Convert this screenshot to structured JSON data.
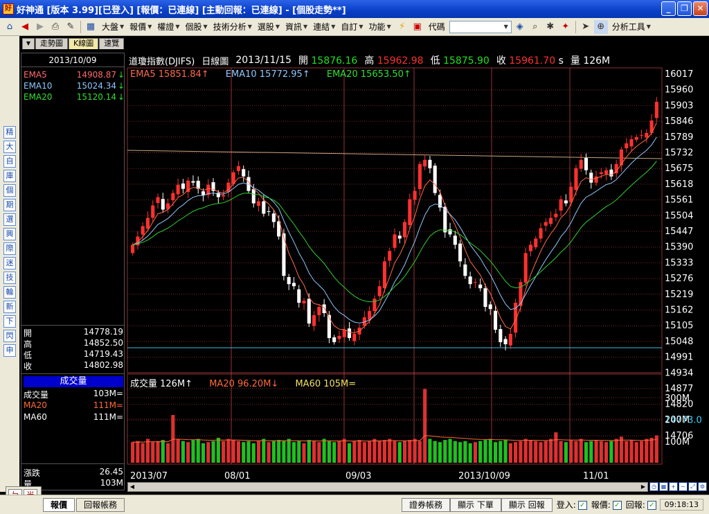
{
  "window": {
    "title": "好神通 [版本 3.99][已登入] [報價：已連線] [主動回報：已連線] - [個股走勢**]",
    "app_icon_glyph": "好",
    "buttons": {
      "minimize": "_",
      "restore": "❐",
      "close": "✕"
    }
  },
  "toolbar": {
    "menus": [
      "大盤",
      "報價",
      "權證",
      "個股",
      "技術分析",
      "選股",
      "資訊",
      "連結",
      "自訂",
      "功能"
    ],
    "code_label": "代碼",
    "code_value": "",
    "analysis_tools": "分析工具"
  },
  "side_buttons": [
    "精",
    "大",
    "自",
    "庫",
    "個",
    "期",
    "選",
    "興",
    "際",
    "迷",
    "技",
    "輪",
    "新",
    "下",
    "閃",
    "申"
  ],
  "tabs": [
    "走勢圖",
    "K線圖",
    "速覽"
  ],
  "left_panel": {
    "date": "2013/10/09",
    "ema": [
      {
        "name": "EMA5",
        "value": "14908.87",
        "arrow": "↓",
        "color": "#ff6a6a"
      },
      {
        "name": "EMA10",
        "value": "15024.34",
        "arrow": "↓",
        "color": "#8ec8ff"
      },
      {
        "name": "EMA20",
        "value": "15120.14",
        "arrow": "↓",
        "color": "#30e030"
      }
    ],
    "ohlc": [
      {
        "label": "開",
        "value": "14778.19"
      },
      {
        "label": "高",
        "value": "14852.50"
      },
      {
        "label": "低",
        "value": "14719.43"
      },
      {
        "label": "收",
        "value": "14802.98"
      }
    ],
    "volume_header": "成交量",
    "volume": [
      {
        "label": "成交量",
        "value": "103M=",
        "color": "#ffffff"
      },
      {
        "label": "MA20",
        "value": "111M=",
        "color": "#ff6a3a"
      },
      {
        "label": "MA60",
        "value": "111M=",
        "color": "#ffffff"
      }
    ],
    "change_label": "漲跌",
    "change_value": "26.45",
    "qty_label": "量",
    "qty_value": "103M"
  },
  "chart_header": {
    "name": "道瓊指數(DJIFS)",
    "period": "日線圖",
    "date": "2013/11/15",
    "open_label": "開",
    "open": "15876.16",
    "high_label": "高",
    "high": "15962.98",
    "low_label": "低",
    "low": "15875.90",
    "close_label": "收",
    "close": "15961.70",
    "close_suffix": "s",
    "vol_label": "量",
    "vol": "126M"
  },
  "ma_legend": {
    "ema5": "EMA5 15851.84↑",
    "ema10": "EMA10 15772.95↑",
    "ema20": "EMA20 15653.50↑"
  },
  "volume_legend": {
    "vol": "成交量 126M↑",
    "ma20": "MA20 96.20M↓",
    "ma60": "MA60 105M="
  },
  "colors": {
    "up": "#ff3030",
    "down": "#20e020",
    "ema5": "#ff6a4a",
    "ema10": "#8ec8ff",
    "ema20": "#30d030",
    "ma20_vol": "#ff6a3a",
    "ma60_vol": "#f0e060",
    "bg": "#000000",
    "grid": "#7a2a2a"
  },
  "chart_data": {
    "type": "candlestick",
    "price_ticks": [
      "16017",
      "15960",
      "15903",
      "15846",
      "15789",
      "15732",
      "15675",
      "15618",
      "15561",
      "15504",
      "15447",
      "15390",
      "15333",
      "15276",
      "15219",
      "15162",
      "15105",
      "15048",
      "14991",
      "14934",
      "14877",
      "14820",
      "14773.0",
      "14706"
    ],
    "y_range": [
      14706,
      16017
    ],
    "volume_ticks": [
      "300M",
      "200M",
      "100M"
    ],
    "x_labels": [
      "2013/07",
      "08/01",
      "09/03",
      "2013/10/09",
      "11/01"
    ],
    "current_price_label": "14773.0",
    "candles_close": [
      15270,
      15310,
      15360,
      15400,
      15460,
      15500,
      15440,
      15470,
      15520,
      15560,
      15540,
      15580,
      15570,
      15540,
      15510,
      15560,
      15530,
      15500,
      15510,
      15570,
      15620,
      15650,
      15600,
      15530,
      15470,
      15480,
      15420,
      15430,
      15380,
      15310,
      15120,
      15080,
      15070,
      14990,
      15000,
      14890,
      14930,
      14970,
      14940,
      14820,
      14800,
      14830,
      14860,
      14820,
      14840,
      14870,
      14920,
      14950,
      15010,
      15070,
      15190,
      15240,
      15320,
      15300,
      15380,
      15490,
      15530,
      15660,
      15680,
      15640,
      15520,
      15450,
      15330,
      15320,
      15270,
      15190,
      15120,
      15080,
      15090,
      15060,
      14970,
      14960,
      14860,
      14800,
      14790,
      14840,
      14990,
      15090,
      15230,
      15270,
      15300,
      15350,
      15380,
      15400,
      15420,
      15490,
      15470,
      15550,
      15640,
      15680,
      15630,
      15570,
      15600,
      15620,
      15630,
      15600,
      15660,
      15730,
      15760,
      15780,
      15790,
      15800,
      15810,
      15870,
      15960
    ],
    "volumes_m": [
      95,
      100,
      90,
      110,
      95,
      100,
      105,
      90,
      220,
      110,
      100,
      95,
      105,
      110,
      90,
      95,
      100,
      115,
      100,
      110,
      105,
      100,
      95,
      100,
      90,
      100,
      110,
      95,
      100,
      105,
      100,
      110,
      95,
      100,
      90,
      105,
      100,
      95,
      110,
      100,
      95,
      100,
      110,
      90,
      100,
      105,
      95,
      100,
      110,
      100,
      105,
      110,
      100,
      95,
      100,
      105,
      110,
      100,
      340,
      110,
      100,
      95,
      105,
      110,
      100,
      95,
      100,
      90,
      95,
      100,
      105,
      110,
      95,
      100,
      105,
      90,
      95,
      100,
      110,
      105,
      100,
      95,
      100,
      110,
      140,
      100,
      95,
      105,
      100,
      110,
      95,
      100,
      105,
      100,
      95,
      100,
      110,
      120,
      100,
      105,
      95,
      100,
      110,
      115,
      126
    ]
  }
}
